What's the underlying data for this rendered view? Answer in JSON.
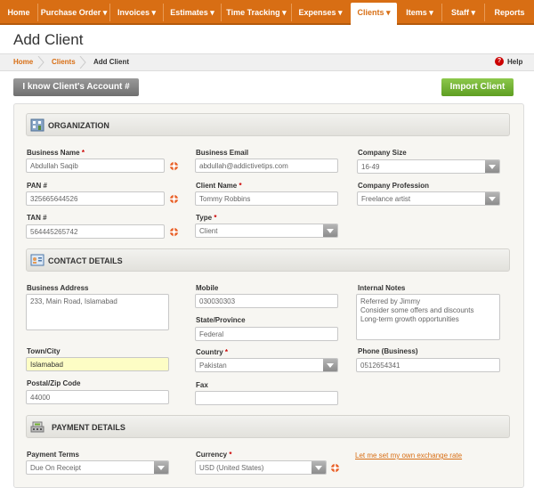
{
  "nav": {
    "items": [
      {
        "label": "Home"
      },
      {
        "label": "Purchase Order ▾"
      },
      {
        "label": "Invoices ▾"
      },
      {
        "label": "Estimates ▾"
      },
      {
        "label": "Time Tracking ▾"
      },
      {
        "label": "Expenses ▾"
      },
      {
        "label": "Clients ▾",
        "active": true
      },
      {
        "label": "Items ▾"
      },
      {
        "label": "Staff ▾"
      },
      {
        "label": "Reports"
      }
    ]
  },
  "page": {
    "title": "Add Client"
  },
  "breadcrumb": {
    "home": "Home",
    "clients": "Clients",
    "current": "Add Client"
  },
  "help": {
    "label": "Help"
  },
  "buttons": {
    "know_account": "I know Client's Account #",
    "import": "Import Client"
  },
  "sections": {
    "organization": "ORGANIZATION",
    "contact": "CONTACT DETAILS",
    "payment": "PAYMENT DETAILS"
  },
  "org": {
    "business_name_label": "Business Name",
    "business_name": "Abdullah Saqib",
    "pan_label": "PAN #",
    "pan": "325665644526",
    "tan_label": "TAN #",
    "tan": "564445265742",
    "email_label": "Business Email",
    "email": "abdullah@addictivetips.com",
    "client_name_label": "Client Name",
    "client_name": "Tommy Robbins",
    "type_label": "Type",
    "type": "Client",
    "company_size_label": "Company Size",
    "company_size": "16-49",
    "profession_label": "Company Profession",
    "profession": "Freelance artist"
  },
  "contact": {
    "address_label": "Business Address",
    "address": "233, Main Road, Islamabad",
    "city_label": "Town/City",
    "city": "Islamabad",
    "zip_label": "Postal/Zip Code",
    "zip": "44000",
    "mobile_label": "Mobile",
    "mobile": "030030303",
    "state_label": "State/Province",
    "state": "Federal",
    "country_label": "Country",
    "country": "Pakistan",
    "fax_label": "Fax",
    "fax": "",
    "notes_label": "Internal Notes",
    "notes": [
      "Referred by Jimmy",
      "Consider some offers and discounts",
      "Long-term growth opportunities"
    ],
    "phone_label": "Phone (Business)",
    "phone": "0512654341"
  },
  "payment": {
    "terms_label": "Payment Terms",
    "terms": "Due On Receipt",
    "currency_label": "Currency",
    "currency": "USD (United States)",
    "exchange_link": "Let me set my own exchange rate"
  },
  "required_marker": "*",
  "colors": {
    "nav": "#d86e14",
    "accent_link": "#d86e14",
    "import_btn": "#6fae2e",
    "gray_btn": "#7d7d7d",
    "required": "#cc0000"
  }
}
